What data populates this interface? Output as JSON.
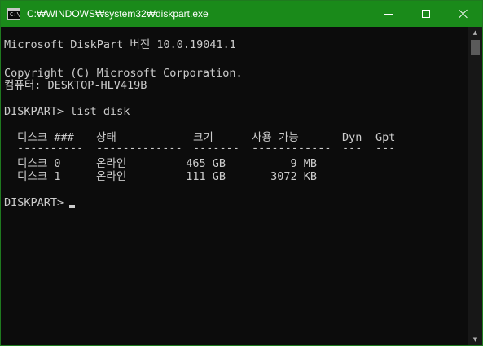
{
  "window": {
    "title": "C:₩WINDOWS₩system32₩diskpart.exe",
    "accent_color": "#1a8a1a",
    "icon": "console-icon",
    "icon_prompt": "C:\\",
    "controls": {
      "minimize_icon": "minimize-icon",
      "maximize_icon": "maximize-icon",
      "close_icon": "close-icon"
    }
  },
  "console": {
    "background": "#0c0c0c",
    "foreground": "#cccccc",
    "banner": "Microsoft DiskPart 버전 10.0.19041.1",
    "copyright": "Copyright (C) Microsoft Corporation.",
    "computer": "컴퓨터: DESKTOP-HLV419B",
    "command_line": "DISKPART> list disk",
    "prompt": "DISKPART> ",
    "disk_table": {
      "headers": [
        "디스크 ###",
        "상태",
        "크기",
        "사용 가능",
        "Dyn",
        "Gpt"
      ],
      "separators": [
        "----------",
        "-------------",
        "-------",
        "------------",
        "---",
        "---"
      ],
      "rows": [
        [
          "디스크 0",
          "온라인",
          "465 GB",
          "9 MB",
          "",
          ""
        ],
        [
          "디스크 1",
          "온라인",
          "111 GB",
          "3072 KB",
          "",
          ""
        ]
      ]
    }
  },
  "scrollbar": {
    "up_icon": "scroll-up-arrow-icon",
    "down_icon": "scroll-down-arrow-icon"
  }
}
